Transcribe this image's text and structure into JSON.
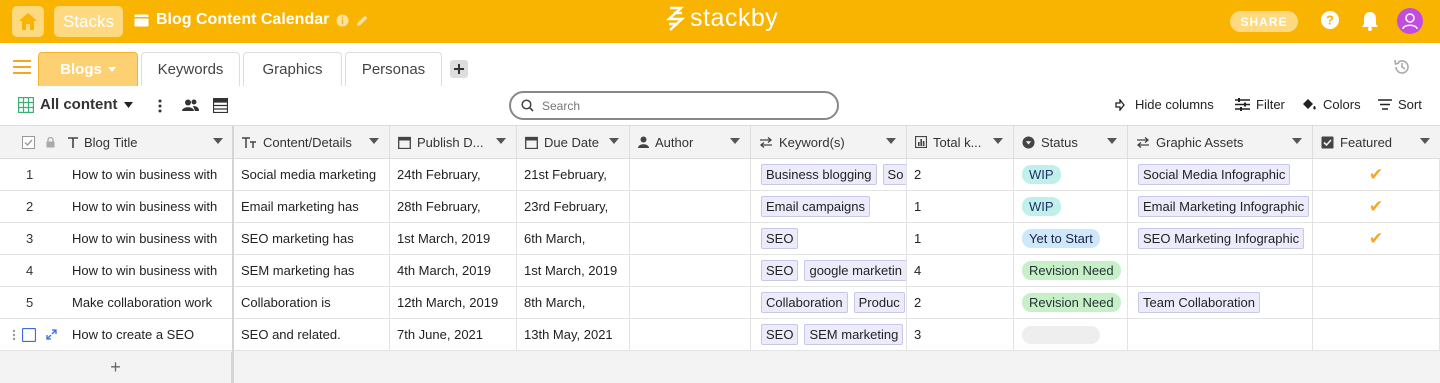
{
  "topbar": {
    "stacks_label": "Stacks",
    "doc_title": "Blog Content Calendar",
    "logo_text": "stackby",
    "share_label": "SHARE",
    "accent_color": "#f8b400"
  },
  "tabs": [
    {
      "label": "Blogs",
      "active": true
    },
    {
      "label": "Keywords",
      "active": false
    },
    {
      "label": "Graphics",
      "active": false
    },
    {
      "label": "Personas",
      "active": false
    }
  ],
  "toolbar": {
    "view_label": "All content",
    "search_placeholder": "Search",
    "hide_columns": "Hide columns",
    "filter": "Filter",
    "colors": "Colors",
    "sort": "Sort"
  },
  "columns": {
    "blog_title": "Blog Title",
    "content": "Content/Details",
    "publish": "Publish D...",
    "due": "Due Date",
    "author": "Author",
    "keywords": "Keyword(s)",
    "total": "Total k...",
    "status": "Status",
    "graphic": "Graphic Assets",
    "featured": "Featured"
  },
  "rows": [
    {
      "num": "1",
      "title": "How to win business with",
      "content": "Social media marketing",
      "publish": "24th February,",
      "due": "21st February,",
      "author": "",
      "keywords": [
        "Business blogging",
        "So"
      ],
      "total": "2",
      "status": "WIP",
      "graphic": "Social Media Infographic",
      "featured": "✔"
    },
    {
      "num": "2",
      "title": "How to win business with",
      "content": "Email marketing has",
      "publish": "28th February,",
      "due": "23rd February,",
      "author": "",
      "keywords": [
        "Email campaigns"
      ],
      "total": "1",
      "status": "WIP",
      "graphic": "Email Marketing Infographic",
      "featured": "✔"
    },
    {
      "num": "3",
      "title": "How to win business with",
      "content": "SEO marketing has",
      "publish": "1st March, 2019",
      "due": "6th March,",
      "author": "",
      "keywords": [
        "SEO"
      ],
      "total": "1",
      "status": "Yet to Start",
      "graphic": "SEO Marketing Infographic",
      "featured": "✔"
    },
    {
      "num": "4",
      "title": "How to win business with",
      "content": "SEM marketing has",
      "publish": "4th March, 2019",
      "due": "1st March, 2019",
      "author": "",
      "keywords": [
        "SEO",
        "google marketin"
      ],
      "total": "4",
      "status": "Revision Need",
      "graphic": "",
      "featured": ""
    },
    {
      "num": "5",
      "title": "Make collaboration work",
      "content": "Collaboration is",
      "publish": "12th March, 2019",
      "due": "8th March,",
      "author": "",
      "keywords": [
        "Collaboration",
        "Produc"
      ],
      "total": "2",
      "status": "Revision Need",
      "graphic": "Team Collaboration",
      "featured": ""
    },
    {
      "num": "",
      "title": "How to create a SEO",
      "content": "SEO and related.",
      "publish": "7th June, 2021",
      "due": "13th May, 2021",
      "author": "",
      "keywords": [
        "SEO",
        "SEM marketing"
      ],
      "total": "3",
      "status": "",
      "graphic": "",
      "featured": ""
    }
  ],
  "add_row_label": "+"
}
